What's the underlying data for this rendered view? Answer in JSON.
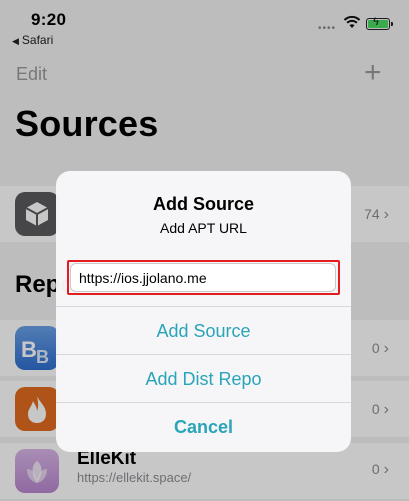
{
  "status_bar": {
    "time": "9:20",
    "back_app": "Safari",
    "dots": "••••"
  },
  "nav": {
    "edit_label": "Edit",
    "add_glyph": "+"
  },
  "page_title": "Sources",
  "first_row": {
    "count": "74"
  },
  "section_header": "Repo",
  "repos": [
    {
      "icon": "bigboss-icon",
      "count": "0"
    },
    {
      "icon": "flame-icon",
      "count": "0"
    },
    {
      "title": "ElleKit",
      "subtitle": "https://ellekit.space/",
      "icon": "ellekit-icon",
      "count": "0"
    }
  ],
  "alert": {
    "title": "Add Source",
    "message": "Add APT URL",
    "input_value": "https://ios.jjolano.me",
    "buttons": {
      "add_source": "Add Source",
      "add_dist": "Add Dist Repo",
      "cancel": "Cancel"
    }
  },
  "colors": {
    "accent": "#2aa4b8",
    "highlight": "#e21d1d",
    "battery": "#4cd964"
  }
}
